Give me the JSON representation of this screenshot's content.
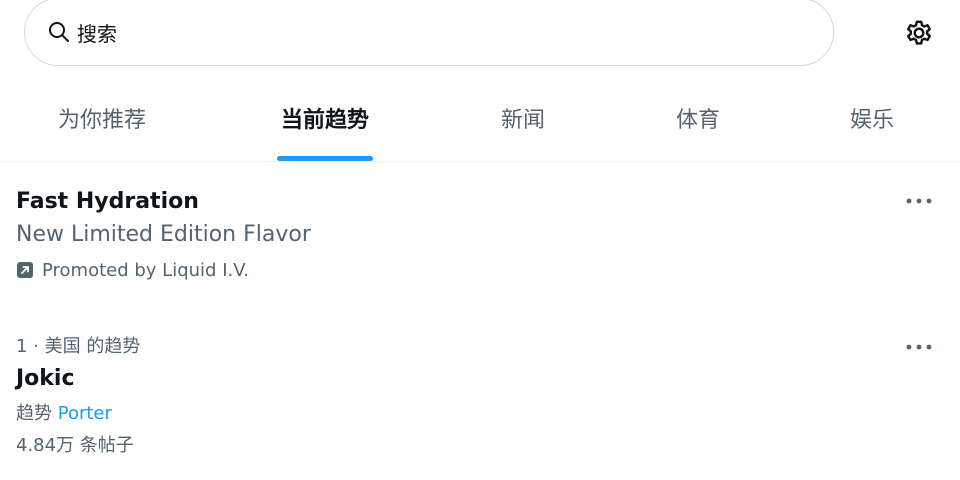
{
  "search": {
    "placeholder": "搜索"
  },
  "icons": {
    "search": "search-icon",
    "settings": "gear-icon",
    "more": "more-horizontal-icon",
    "promoted": "promoted-arrow-icon"
  },
  "colors": {
    "accent": "#1d9bf0",
    "text_primary": "#0f1419",
    "text_secondary": "#536471",
    "border": "#cfd9de"
  },
  "tabs": [
    {
      "label": "为你推荐",
      "active": false
    },
    {
      "label": "当前趋势",
      "active": true
    },
    {
      "label": "新闻",
      "active": false
    },
    {
      "label": "体育",
      "active": false
    },
    {
      "label": "娱乐",
      "active": false
    }
  ],
  "promoted_trend": {
    "title": "Fast Hydration",
    "subtitle": "New Limited Edition Flavor",
    "promoted_text": "Promoted by Liquid I.V."
  },
  "trend_1": {
    "context": "1 · 美国 的趋势",
    "title": "Jokic",
    "related_prefix": "趋势",
    "related_link": "Porter",
    "posts": "4.84万 条帖子"
  }
}
